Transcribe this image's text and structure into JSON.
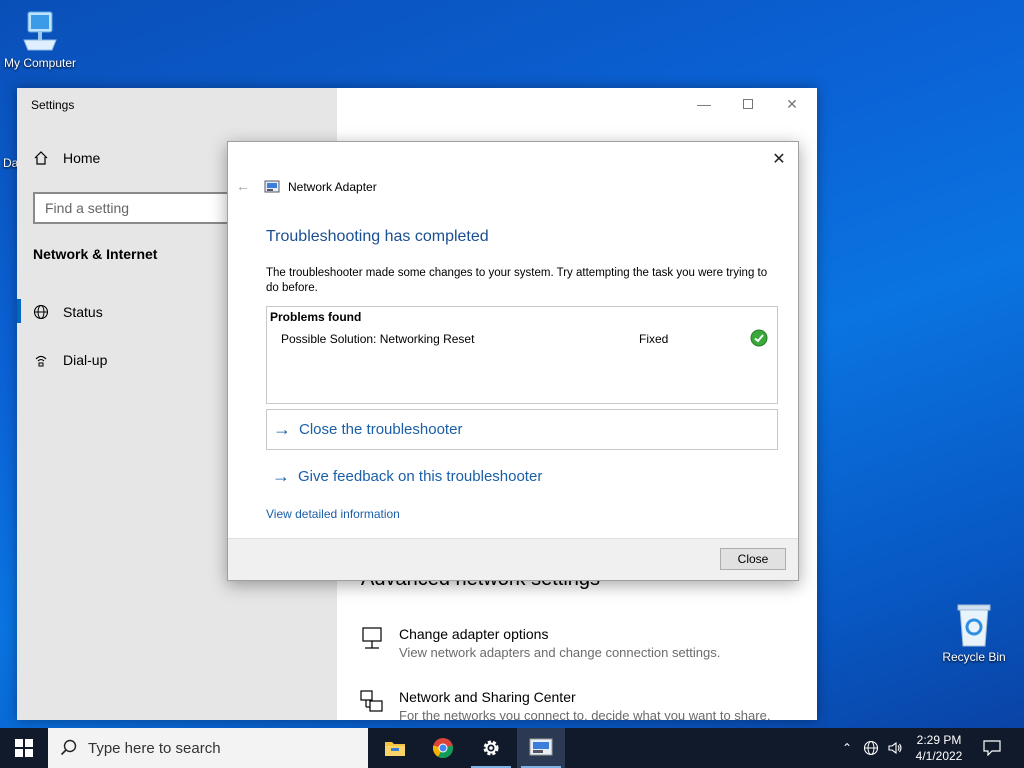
{
  "desktop": {
    "my_computer_label": "My Computer",
    "recycle_bin_label": "Recycle Bin",
    "partial_label": "Da"
  },
  "settings": {
    "title": "Settings",
    "nav_home": "Home",
    "search_placeholder": "Find a setting",
    "section_header": "Network & Internet",
    "nav_items": [
      {
        "label": "Status",
        "icon": "globe-icon",
        "selected": true
      },
      {
        "label": "Dial-up",
        "icon": "dial-up-icon",
        "selected": false
      }
    ],
    "advanced_title": "Advanced network settings",
    "options": [
      {
        "title": "Change adapter options",
        "desc": "View network adapters and change connection settings.",
        "icon": "monitor-network-icon"
      },
      {
        "title": "Network and Sharing Center",
        "desc": "For the networks you connect to, decide what you want to share.",
        "icon": "sharing-center-icon"
      }
    ]
  },
  "dialog": {
    "header": "Network Adapter",
    "heading": "Troubleshooting has completed",
    "description": "The troubleshooter made some changes to your system. Try attempting the task you were trying to do before.",
    "problems_header": "Problems found",
    "problems": [
      {
        "name": "Possible Solution: Networking Reset",
        "status": "Fixed",
        "icon": "check-circle-icon"
      }
    ],
    "link_close": "Close the troubleshooter",
    "link_feedback": "Give feedback on this troubleshooter",
    "detail_link": "View detailed information",
    "close_button": "Close"
  },
  "taskbar": {
    "search_placeholder": "Type here to search",
    "time": "2:29 PM",
    "date": "4/1/2022"
  },
  "colors": {
    "accent": "#0067c0",
    "link": "#1a5fa8",
    "heading": "#1a4f93",
    "check": "#3aa83a"
  }
}
